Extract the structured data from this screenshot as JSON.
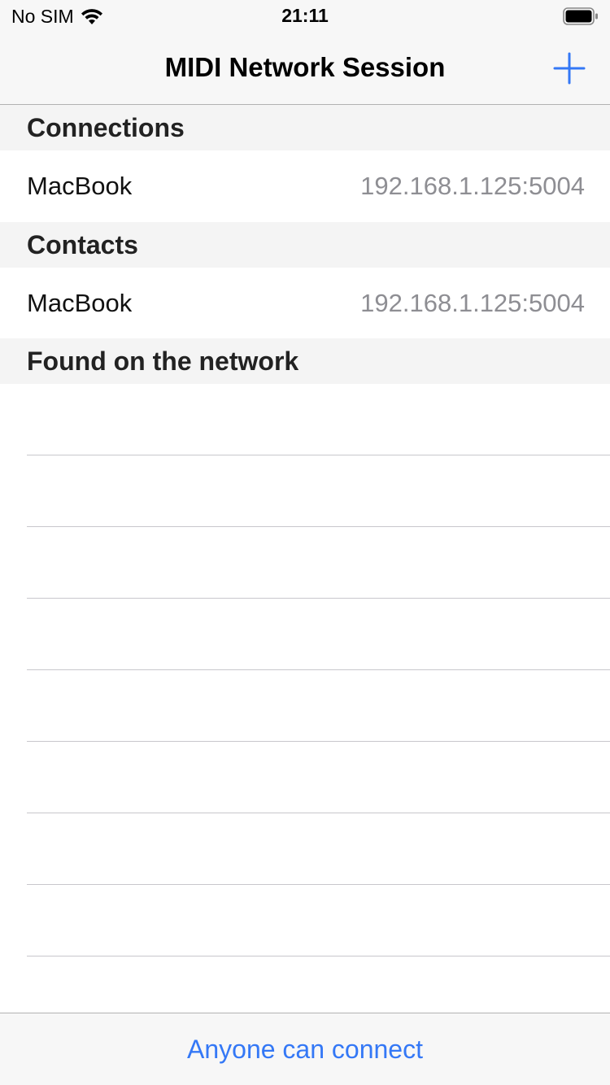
{
  "status_bar": {
    "carrier": "No SIM",
    "time": "21:11",
    "wifi_icon": "wifi-icon",
    "battery_icon": "battery-icon"
  },
  "nav": {
    "title": "MIDI Network Session",
    "add_icon": "plus-icon",
    "accent_color": "#3478f6"
  },
  "sections": {
    "connections": {
      "header": "Connections",
      "rows": [
        {
          "name": "MacBook",
          "address": "192.168.1.125:5004"
        }
      ]
    },
    "contacts": {
      "header": "Contacts",
      "rows": [
        {
          "name": "MacBook",
          "address": "192.168.1.125:5004"
        }
      ]
    },
    "found": {
      "header": "Found on the network",
      "rows": []
    }
  },
  "toolbar": {
    "access_label": "Anyone can connect"
  }
}
